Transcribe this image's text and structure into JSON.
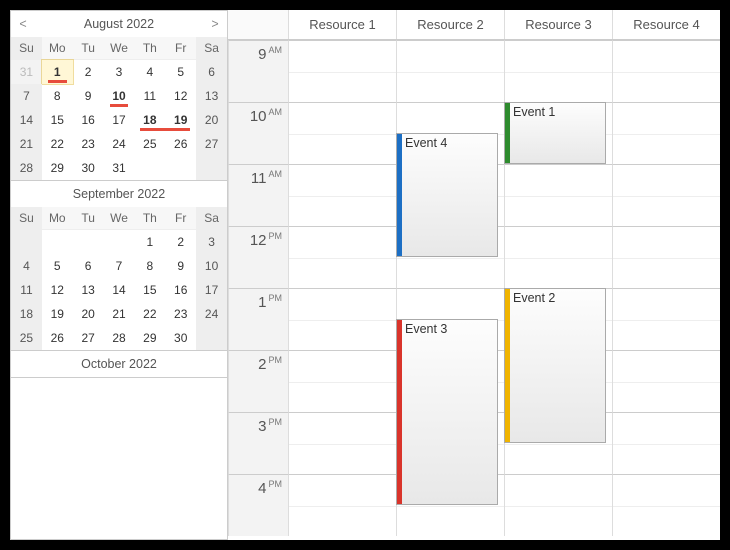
{
  "nav": {
    "months": [
      {
        "title": "August 2022",
        "showNav": true,
        "prev": "<",
        "next": ">",
        "weeks": [
          [
            {
              "n": 31,
              "other": true
            },
            {
              "n": 1,
              "selected": true,
              "bold": true,
              "redbar": true
            },
            {
              "n": 2
            },
            {
              "n": 3
            },
            {
              "n": 4
            },
            {
              "n": 5
            },
            {
              "n": 6,
              "we": true
            }
          ],
          [
            {
              "n": 7,
              "we": true
            },
            {
              "n": 8
            },
            {
              "n": 9
            },
            {
              "n": 10,
              "bold": true,
              "redbar": true
            },
            {
              "n": 11
            },
            {
              "n": 12
            },
            {
              "n": 13,
              "we": true
            }
          ],
          [
            {
              "n": 14,
              "we": true
            },
            {
              "n": 15
            },
            {
              "n": 16
            },
            {
              "n": 17
            },
            {
              "n": 18,
              "bold": true,
              "redbarWide": true
            },
            {
              "n": 19,
              "bold": true
            },
            {
              "n": 20,
              "we": true
            }
          ],
          [
            {
              "n": 21,
              "we": true
            },
            {
              "n": 22
            },
            {
              "n": 23
            },
            {
              "n": 24
            },
            {
              "n": 25
            },
            {
              "n": 26
            },
            {
              "n": 27,
              "we": true
            }
          ],
          [
            {
              "n": 28,
              "we": true
            },
            {
              "n": 29
            },
            {
              "n": 30
            },
            {
              "n": 31
            },
            {
              "n": "",
              "blank": true
            },
            {
              "n": "",
              "blank": true
            },
            {
              "n": "",
              "blank": true,
              "we": true
            }
          ]
        ]
      },
      {
        "title": "September 2022",
        "showNav": false,
        "weeks": [
          [
            {
              "n": "",
              "blank": true
            },
            {
              "n": "",
              "blank": true
            },
            {
              "n": "",
              "blank": true
            },
            {
              "n": "",
              "blank": true
            },
            {
              "n": 1
            },
            {
              "n": 2
            },
            {
              "n": 3,
              "we": true
            }
          ],
          [
            {
              "n": 4,
              "we": true
            },
            {
              "n": 5
            },
            {
              "n": 6
            },
            {
              "n": 7
            },
            {
              "n": 8
            },
            {
              "n": 9
            },
            {
              "n": 10,
              "we": true
            }
          ],
          [
            {
              "n": 11,
              "we": true
            },
            {
              "n": 12
            },
            {
              "n": 13
            },
            {
              "n": 14
            },
            {
              "n": 15
            },
            {
              "n": 16
            },
            {
              "n": 17,
              "we": true
            }
          ],
          [
            {
              "n": 18,
              "we": true
            },
            {
              "n": 19
            },
            {
              "n": 20
            },
            {
              "n": 21
            },
            {
              "n": 22
            },
            {
              "n": 23
            },
            {
              "n": 24,
              "we": true
            }
          ],
          [
            {
              "n": 25,
              "we": true
            },
            {
              "n": 26
            },
            {
              "n": 27
            },
            {
              "n": 28
            },
            {
              "n": 29
            },
            {
              "n": 30
            },
            {
              "n": "",
              "blank": true,
              "we": true
            }
          ]
        ]
      },
      {
        "title": "October 2022",
        "showNav": false,
        "weeks": []
      }
    ],
    "dow": [
      "Su",
      "Mo",
      "Tu",
      "We",
      "Th",
      "Fr",
      "Sa"
    ]
  },
  "scheduler": {
    "resources": [
      "Resource 1",
      "Resource 2",
      "Resource 3",
      "Resource 4"
    ],
    "hours": [
      {
        "h": "9",
        "ampm": "AM"
      },
      {
        "h": "10",
        "ampm": "AM"
      },
      {
        "h": "11",
        "ampm": "AM"
      },
      {
        "h": "12",
        "ampm": "PM"
      },
      {
        "h": "1",
        "ampm": "PM"
      },
      {
        "h": "2",
        "ampm": "PM"
      },
      {
        "h": "3",
        "ampm": "PM"
      },
      {
        "h": "4",
        "ampm": "PM"
      }
    ],
    "events": [
      {
        "id": "event1",
        "title": "Event 1",
        "color": "#2e8b2e",
        "resourceIndex": 2,
        "startHourIndex": 1,
        "startHalf": 0,
        "durationHalves": 2
      },
      {
        "id": "event4",
        "title": "Event 4",
        "color": "#1d6fc4",
        "resourceIndex": 1,
        "startHourIndex": 1,
        "startHalf": 1,
        "durationHalves": 4
      },
      {
        "id": "event2",
        "title": "Event 2",
        "color": "#f0b400",
        "resourceIndex": 2,
        "startHourIndex": 4,
        "startHalf": 0,
        "durationHalves": 5
      },
      {
        "id": "event3",
        "title": "Event 3",
        "color": "#d9342b",
        "resourceIndex": 1,
        "startHourIndex": 4,
        "startHalf": 1,
        "durationHalves": 6
      }
    ]
  }
}
